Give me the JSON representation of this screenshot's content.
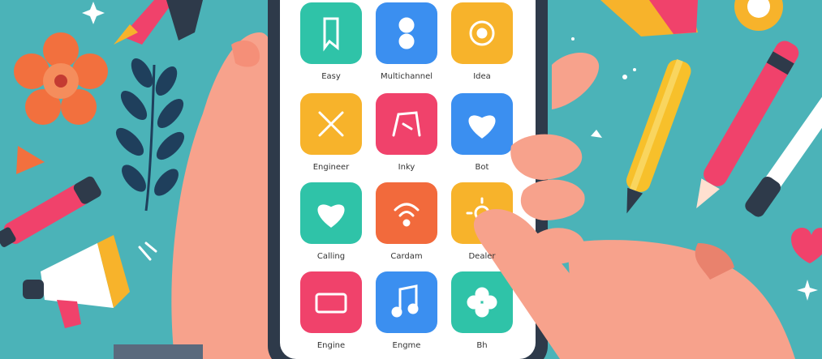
{
  "colors": {
    "background": "#4bb3b8",
    "phone_frame": "#2e3a4a",
    "phone_screen": "#ffffff",
    "skin": "#f7a28c",
    "skin_shadow": "#e9826d",
    "flower": "#f2703e",
    "leaf": "#1f3f5c",
    "pink": "#f0426b",
    "yellow": "#f7c02b"
  },
  "apps": [
    {
      "name": "Easy",
      "icon": "document-icon",
      "color": "#2fc3a8"
    },
    {
      "name": "Multichannel",
      "icon": "toggle-icon",
      "color": "#3b8ff0"
    },
    {
      "name": "Idea",
      "icon": "lightbulb-icon",
      "color": "#f7b32b"
    },
    {
      "name": "Engineer",
      "icon": "tools-icon",
      "color": "#f7b32b"
    },
    {
      "name": "Inky",
      "icon": "figure-icon",
      "color": "#f0426b"
    },
    {
      "name": "Bot",
      "icon": "heart-icon",
      "color": "#3b8ff0"
    },
    {
      "name": "Calling",
      "icon": "heart-icon",
      "color": "#2fc3a8"
    },
    {
      "name": "Cardam",
      "icon": "wifi-icon",
      "color": "#f26a3c"
    },
    {
      "name": "Dealer",
      "icon": "sun-icon",
      "color": "#f7b32b"
    },
    {
      "name": "Engine",
      "icon": "folder-icon",
      "color": "#f0426b"
    },
    {
      "name": "Engme",
      "icon": "music-note-icon",
      "color": "#3b8ff0"
    },
    {
      "name": "Bh",
      "icon": "flower-icon",
      "color": "#2fc3a8"
    }
  ]
}
